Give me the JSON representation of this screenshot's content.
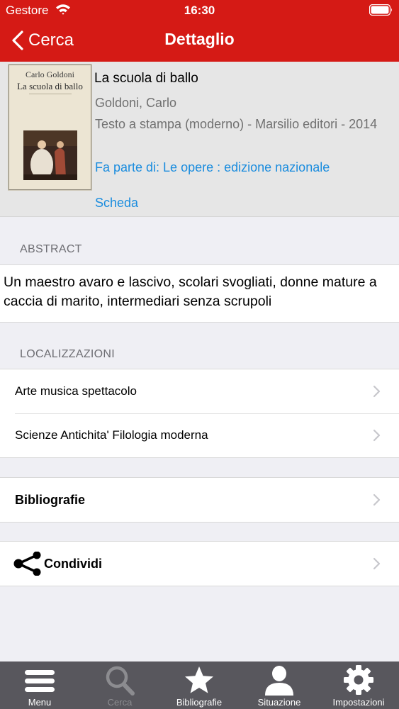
{
  "status_bar": {
    "carrier": "Gestore",
    "time": "16:30"
  },
  "navbar": {
    "back_label": "Cerca",
    "title": "Dettaglio"
  },
  "book": {
    "cover_author": "Carlo Goldoni",
    "cover_title": "La scuola di ballo",
    "title": "La scuola di ballo",
    "author": "Goldoni, Carlo",
    "edition": "Testo a stampa (moderno) - Marsilio editori - 2014",
    "series_link": "Fa parte di: Le opere : edizione nazionale",
    "scheda_link": "Scheda"
  },
  "abstract": {
    "header": "ABSTRACT",
    "text": "Un maestro avaro e lascivo, scolari svogliati, donne mature a caccia di marito, intermediari senza scrupoli"
  },
  "localizzazioni": {
    "header": "LOCALIZZAZIONI",
    "items": [
      {
        "label": "Arte musica spettacolo"
      },
      {
        "label": "Scienze Antichita' Filologia moderna"
      }
    ]
  },
  "bibliografie": {
    "label": "Bibliografie"
  },
  "condividi": {
    "label": "Condividi"
  },
  "tabbar": {
    "tabs": [
      {
        "label": "Menu",
        "icon": "menu-icon",
        "active": true
      },
      {
        "label": "Cerca",
        "icon": "search-icon",
        "active": false
      },
      {
        "label": "Bibliografie",
        "icon": "star-icon",
        "active": true
      },
      {
        "label": "Situazione",
        "icon": "user-icon",
        "active": true
      },
      {
        "label": "Impostazioni",
        "icon": "gear-icon",
        "active": true
      }
    ]
  },
  "colors": {
    "header_bg": "#d51a15",
    "link": "#1a8cde",
    "tabbar_bg": "#58575d"
  }
}
